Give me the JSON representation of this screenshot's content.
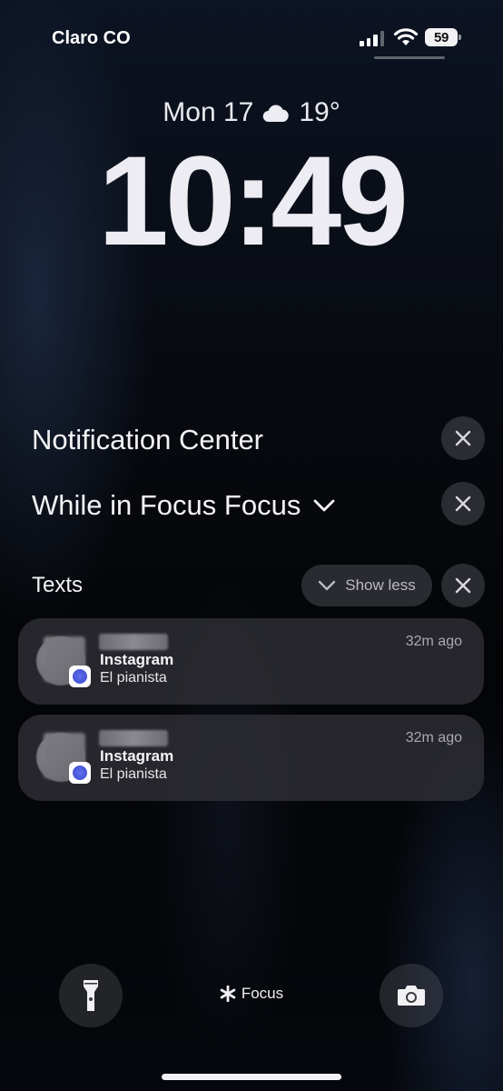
{
  "status_bar": {
    "carrier": "Claro CO",
    "battery_level": "59",
    "signal_bars_active": 3
  },
  "lock_screen": {
    "date": "Mon 17",
    "weather_icon": "cloud-icon",
    "temperature": "19°",
    "time": "10:49"
  },
  "notification_center": {
    "title": "Notification Center",
    "focus_section_title": "While in Focus Focus",
    "group_label": "Texts",
    "show_less_label": "Show less"
  },
  "notifications": [
    {
      "app": "Instagram",
      "message": "El pianista",
      "time": "32m ago"
    },
    {
      "app": "Instagram",
      "message": "El pianista",
      "time": "32m ago"
    }
  ],
  "bottom_bar": {
    "flashlight_icon": "flashlight-icon",
    "focus_label": "Focus",
    "camera_icon": "camera-icon"
  },
  "colors": {
    "card_bg": "#2e2e34",
    "badge_blue": "#4b5bdc"
  }
}
